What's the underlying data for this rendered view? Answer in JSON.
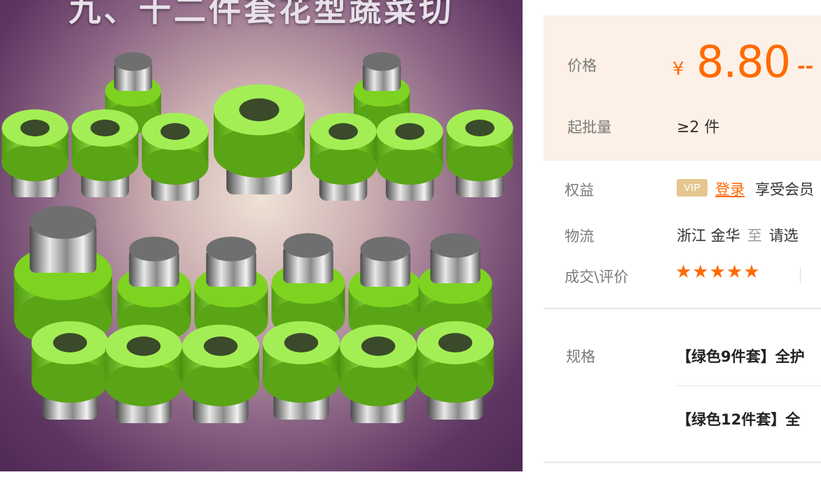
{
  "image": {
    "caption": "九、十二件套花型蔬菜切"
  },
  "price": {
    "label": "价格",
    "currency": "¥",
    "value": "8.80",
    "dash": "--"
  },
  "moq": {
    "label": "起批量",
    "value": "≥2 件"
  },
  "benefits": {
    "label": "权益",
    "vip_badge": "VIP",
    "login_link": "登录",
    "text": "享受会员"
  },
  "logistics": {
    "label": "物流",
    "origin": "浙江 金华",
    "to": "至",
    "destination": "请选"
  },
  "reviews": {
    "label": "成交\\评价",
    "stars": "★★★★★"
  },
  "specs": {
    "label": "规格",
    "items": [
      "【绿色9件套】全护",
      "【绿色12件套】全"
    ]
  },
  "colors": {
    "accent": "#ff6a00",
    "price_bg": "#fdf0e6",
    "vip_gold": "#e6c68f",
    "cutter_green": "#7ed321"
  }
}
